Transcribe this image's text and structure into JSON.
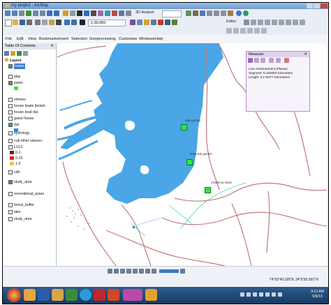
{
  "window": {
    "title": "my project - ArcMap"
  },
  "toolbars": {
    "scale_value": "1:30,000",
    "analyst_label": "3D Analyst",
    "editor_label": "Editor"
  },
  "menu": [
    "File",
    "Edit",
    "View",
    "Bookmarks",
    "Insert",
    "Selection",
    "Geoprocessing",
    "Customize",
    "Windows",
    "Help"
  ],
  "toc": {
    "title": "Table Of Contents",
    "layers_label": "Layers",
    "items": [
      {
        "label": "hotels",
        "checked": true,
        "swatch": null,
        "selected": true
      },
      {
        "label": "play",
        "checked": false,
        "swatch": null
      },
      {
        "label": "parks",
        "checked": true,
        "swatch": "#2ee83a"
      },
      {
        "label": "shrines",
        "checked": false,
        "swatch": null
      },
      {
        "label": "house boats jhelum",
        "checked": false,
        "swatch": null
      },
      {
        "label": "house boat dal",
        "checked": false,
        "swatch": null
      },
      {
        "label": "guest house",
        "checked": false,
        "swatch": null
      },
      {
        "label": "dal",
        "checked": true,
        "swatch": "#2f8ddc"
      },
      {
        "label": "hydrology",
        "checked": false,
        "swatch": null
      },
      {
        "label": "<all other values>",
        "checked": false,
        "swatch": null
      },
      {
        "label": "LULC",
        "checked": false,
        "swatch": null
      },
      {
        "label": "0-1",
        "checked": false,
        "swatch": "#7a1616"
      },
      {
        "label": "0-15",
        "checked": false,
        "swatch": "#d8261d"
      },
      {
        "label": "1-5",
        "checked": false,
        "swatch": "#f3c343"
      },
      {
        "label": "cdh",
        "checked": false,
        "swatch": null
      },
      {
        "label": "study_area",
        "checked": true,
        "swatch": null
      },
      {
        "label": "recreational_areas",
        "checked": false,
        "swatch": null
      },
      {
        "label": "forest_buffer",
        "checked": false,
        "swatch": null
      },
      {
        "label": "lake",
        "checked": false,
        "swatch": null
      },
      {
        "label": "study_area",
        "checked": false,
        "swatch": null
      }
    ]
  },
  "map": {
    "labels": [
      "tulip garden",
      "botanical garden",
      "Chashma shahi"
    ],
    "water_color": "#4aa6e6",
    "road_color": "#c2797b",
    "park_color": "#2ee83a"
  },
  "measure": {
    "title": "Measure",
    "result_title": "Line measurement (Planar)",
    "segment": "Segment: 6.162803 Kilometers",
    "length": "Length: 3.176277 Kilometers"
  },
  "status": {
    "coordinates": "74°52'49.185\"E  34°5'56.591\"N"
  },
  "taskbar": {
    "time": "3:12 AM",
    "date": "5/6/13"
  }
}
